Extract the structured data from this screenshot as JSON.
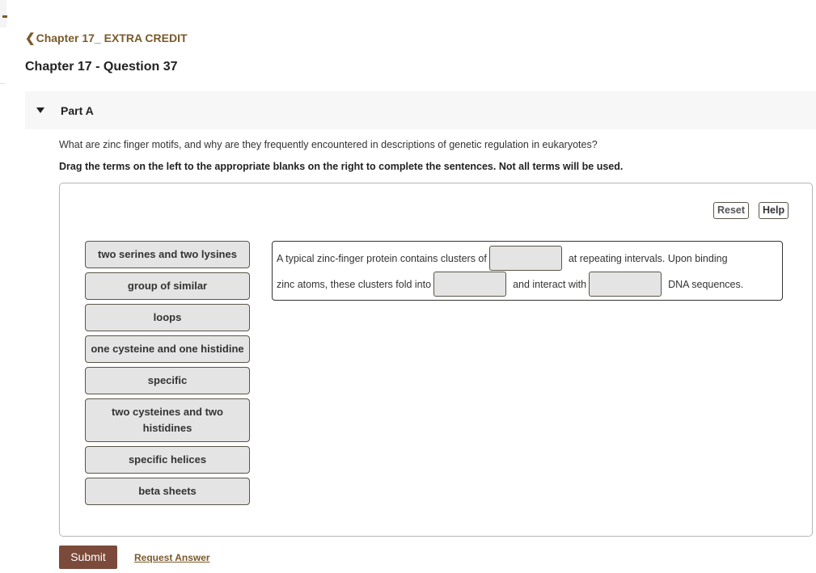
{
  "breadcrumb": {
    "label": "Chapter 17_ EXTRA CREDIT",
    "icon": "chevron-left-icon"
  },
  "page_title": "Chapter 17 - Question 37",
  "part": {
    "label": "Part A",
    "icon": "caret-down-icon",
    "expanded": true
  },
  "question": "What are zinc finger motifs, and why are they frequently encountered in descriptions of genetic regulation in eukaryotes?",
  "instruction": "Drag the terms on the left to the appropriate blanks on the right to complete the sentences. Not all terms will be used.",
  "toolbar": {
    "reset_label": "Reset",
    "help_label": "Help"
  },
  "terms": [
    "two serines and two lysines",
    "group of similar",
    "loops",
    "one cysteine and one histidine",
    "specific",
    "two cysteines and two histidines",
    "specific helices",
    "beta sheets"
  ],
  "sentence": {
    "line1_a": "A typical zinc-finger protein contains clusters of",
    "line1_b": "at repeating intervals. Upon binding",
    "line2_a": "zinc atoms, these clusters fold into",
    "line2_b": "and interact with",
    "line2_c": "DNA sequences.",
    "blanks": [
      "",
      "",
      ""
    ]
  },
  "footer": {
    "submit_label": "Submit",
    "request_answer_label": "Request Answer"
  },
  "colors": {
    "brand": "#7a5a2a",
    "submit": "#7b4a3a",
    "term_fill": "#e4e4e4"
  }
}
